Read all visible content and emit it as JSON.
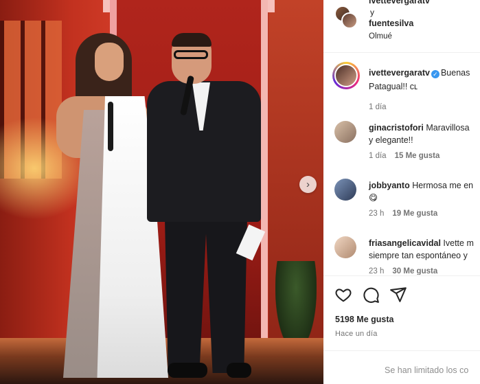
{
  "post": {
    "image_alt": "Photo of a woman in a white gown and a man in a black suit holding microphones on a stage",
    "next_arrow_icon": "chevron-right-icon"
  },
  "header": {
    "author_1": "ivettevergaratv",
    "joiner": "y",
    "author_2": "fuentesilva",
    "location": "Olmué"
  },
  "comments": [
    {
      "username": "ivettevergaratv",
      "verified": true,
      "text": "Buenas",
      "text_line2": "Patagual!! cʟ",
      "time": "1 día",
      "likes": ""
    },
    {
      "username": "ginacristofori",
      "verified": false,
      "text": "Maravillosa",
      "text_line2": "y elegante!!",
      "time": "1 día",
      "likes": "15 Me gusta"
    },
    {
      "username": "jobbyanto",
      "verified": false,
      "text": "Hermosa me en",
      "text_line2": "😋",
      "time": "23 h",
      "likes": "19 Me gusta"
    },
    {
      "username": "friasangelicavidal",
      "verified": false,
      "text": "Ivette m",
      "text_line2": "siempre tan espontáneo y",
      "time": "23 h",
      "likes": "30 Me gusta"
    }
  ],
  "actions": {
    "like_icon": "heart-icon",
    "comment_icon": "comment-icon",
    "share_icon": "share-icon",
    "likes_count": "5198 Me gusta",
    "time_ago": "Hace un día"
  },
  "footer": {
    "limited_text": "Se han limitado los co"
  },
  "colors": {
    "text": "#262626",
    "muted": "#737373",
    "verified": "#3897f0",
    "border": "#efefef"
  }
}
